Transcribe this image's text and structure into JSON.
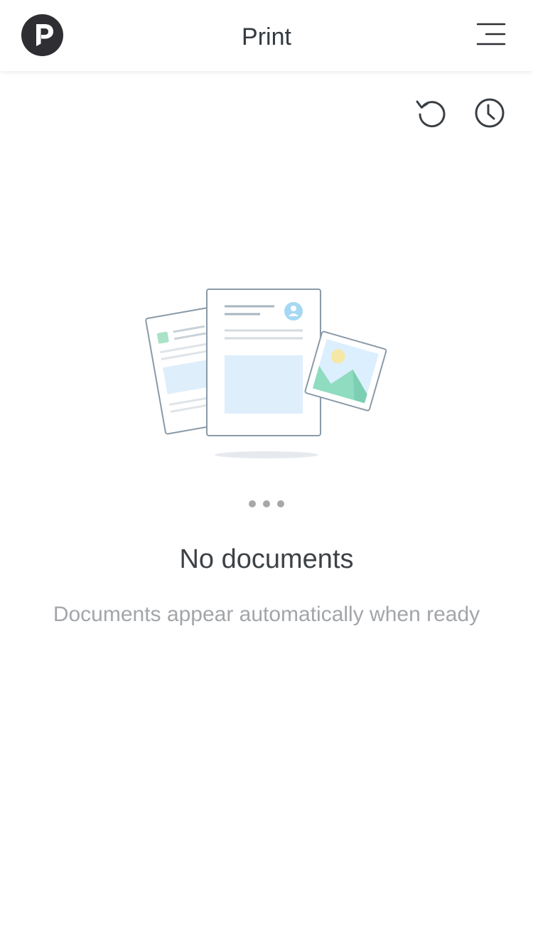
{
  "header": {
    "title": "Print",
    "logo_icon": "brand-logo-icon",
    "menu_icon": "hamburger-menu-icon"
  },
  "toolbar": {
    "refresh_icon": "refresh-icon",
    "history_icon": "history-clock-icon"
  },
  "empty_state": {
    "illustration": "documents-illustration",
    "title": "No documents",
    "subtitle": "Documents appear automatically when ready"
  },
  "colors": {
    "logo": "#2f2f33",
    "title_text": "#333a40",
    "icon_stroke": "#3a3f44",
    "subtitle_text": "#a2a6aa",
    "dots": "#a5a8ab",
    "illustration_outline": "#8a9aa8",
    "illustration_blue": "#dfeefb",
    "illustration_green": "#8fdcc0",
    "illustration_sun": "#f6e7a6"
  }
}
